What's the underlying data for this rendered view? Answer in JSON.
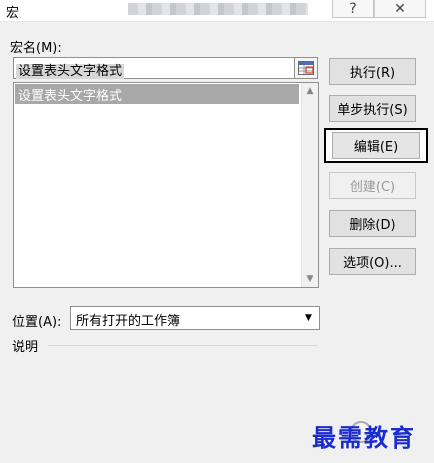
{
  "window": {
    "title": "宏",
    "help_glyph": "?",
    "close_glyph": "✕"
  },
  "macro_name": {
    "label": "宏名(M):",
    "value": "设置表头文字格式"
  },
  "macro_list": {
    "items": [
      "设置表头文字格式"
    ]
  },
  "buttons": {
    "run": "执行(R)",
    "step_into": "单步执行(S)",
    "edit": "编辑(E)",
    "create": "创建(C)",
    "delete": "删除(D)",
    "options": "选项(O)..."
  },
  "location": {
    "label": "位置(A):",
    "value": "所有打开的工作簿"
  },
  "description": {
    "label": "说明"
  },
  "watermark": {
    "text": "最需教育"
  },
  "colors": {
    "watermark": "#1a2bd0",
    "selection": "#a8a8a8"
  }
}
